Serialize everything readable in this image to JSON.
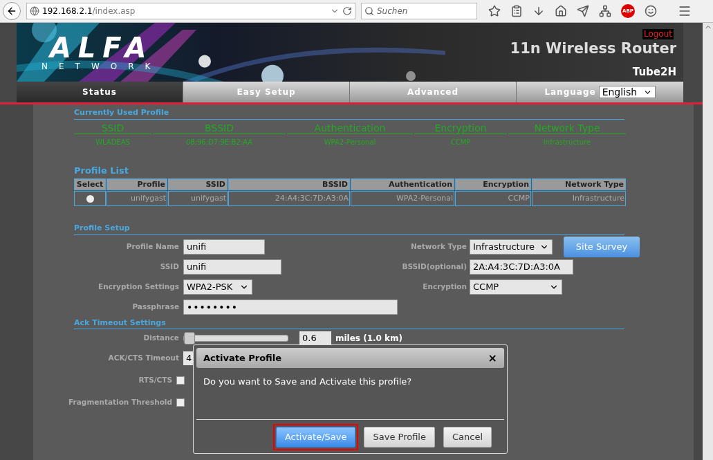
{
  "browser": {
    "url_host": "192.168.2.1",
    "url_path": "/index.asp",
    "search_placeholder": "Suchen",
    "abp_label": "ABP"
  },
  "header": {
    "logo": "ALFA",
    "logo_sub": "NETWORK",
    "logout": "Logout",
    "title": "11n Wireless Router",
    "model": "Tube2H"
  },
  "nav": {
    "tabs": [
      {
        "label": "Status",
        "selected": true
      },
      {
        "label": "Easy Setup",
        "selected": false
      },
      {
        "label": "Advanced",
        "selected": false
      }
    ],
    "language_label": "Language",
    "language": "English"
  },
  "current_profile": {
    "title": "Currently Used Profile",
    "columns": [
      "SSID",
      "BSSID",
      "Authentication",
      "Encryption",
      "Network Type"
    ],
    "row": [
      "WLADEAS",
      "08:96:D7:9E:B2:AA",
      "WPA2-Personal",
      "CCMP",
      "Infrastructure"
    ]
  },
  "profile_list": {
    "title": "Profile List",
    "select_header": "Select",
    "columns": [
      "Profile",
      "SSID",
      "BSSID",
      "Authentication",
      "Encryption",
      "Network Type"
    ],
    "rows": [
      {
        "selected": false,
        "cells": [
          "unifygast",
          "unifygast",
          "24:A4:3C:7D:A3:0A",
          "WPA2-Personal",
          "CCMP",
          "Infrastructure"
        ]
      }
    ]
  },
  "profile_setup": {
    "title": "Profile Setup",
    "left": [
      {
        "label": "Profile Name",
        "value": "unifi",
        "kind": "text"
      },
      {
        "label": "SSID",
        "value": "unifi",
        "kind": "text"
      },
      {
        "label": "Encryption Settings",
        "value": "WPA2-PSK",
        "kind": "select"
      },
      {
        "label": "Passphrase",
        "value": "••••••••",
        "kind": "password"
      }
    ],
    "right": [
      {
        "label": "Network Type",
        "value": "Infrastructure",
        "kind": "select"
      },
      {
        "label": "BSSID(optional)",
        "value": "2A:A4:3C:7D:A3:0A",
        "kind": "text"
      },
      {
        "label": "Encryption",
        "value": "CCMP",
        "kind": "select"
      }
    ],
    "site_survey": "Site Survey"
  },
  "ack_timeout": {
    "title": "Ack Timeout Settings",
    "distance": {
      "label": "Distance",
      "level": 0,
      "value": "0.6",
      "unit": "miles (1.0 km)"
    },
    "ack_cts": {
      "label": "ACK/CTS Timeout",
      "value": "4"
    },
    "rts_cts": {
      "label": "RTS/CTS",
      "checked": false
    },
    "fragmentation": {
      "label": "Fragmentation Threshold",
      "checked": false
    }
  },
  "dialog": {
    "title": "Activate Profile",
    "close": "×",
    "message": "Do you want to Save and Activate this profile?",
    "buttons": [
      {
        "label": "Activate/Save",
        "kind": "primary",
        "focused": true
      },
      {
        "label": "Save Profile",
        "kind": "default",
        "focused": false
      },
      {
        "label": "Cancel",
        "kind": "default",
        "focused": false
      }
    ]
  }
}
